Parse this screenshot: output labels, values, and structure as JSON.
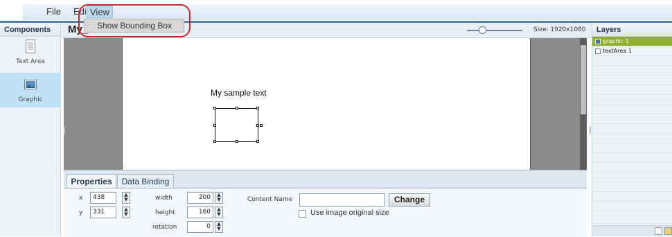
{
  "menubar": {
    "items": [
      {
        "label": "File"
      },
      {
        "label": "Edit"
      },
      {
        "label": "View"
      }
    ]
  },
  "dropdown": {
    "items": [
      {
        "label": "Show Bounding Box"
      }
    ]
  },
  "components": {
    "title": "Components",
    "items": [
      {
        "label": "Text Area",
        "icon": "text-area-icon"
      },
      {
        "label": "Graphic",
        "icon": "graphic-icon"
      }
    ]
  },
  "canvas": {
    "title": "My_",
    "size_label": "Size: 1920x1080",
    "sample_text": "My sample text"
  },
  "properties": {
    "tabs": [
      {
        "label": "Properties"
      },
      {
        "label": "Data Binding"
      }
    ],
    "x_label": "x",
    "x_value": "438",
    "y_label": "y",
    "y_value": "331",
    "width_label": "width",
    "width_value": "200",
    "height_label": "height",
    "height_value": "160",
    "rotation_label": "rotation",
    "rotation_value": "0",
    "content_name_label": "Content Name",
    "content_name_value": "",
    "change_button": "Change",
    "use_original_label": "Use image original size"
  },
  "layers": {
    "title": "Layers",
    "items": [
      {
        "label": "graphic 1",
        "selected": true
      },
      {
        "label": "textArea 1",
        "selected": false
      }
    ]
  },
  "colors": {
    "accent": "#4f81ad",
    "selected_layer": "#8fb02c",
    "highlight_ring": "#c9282e"
  }
}
